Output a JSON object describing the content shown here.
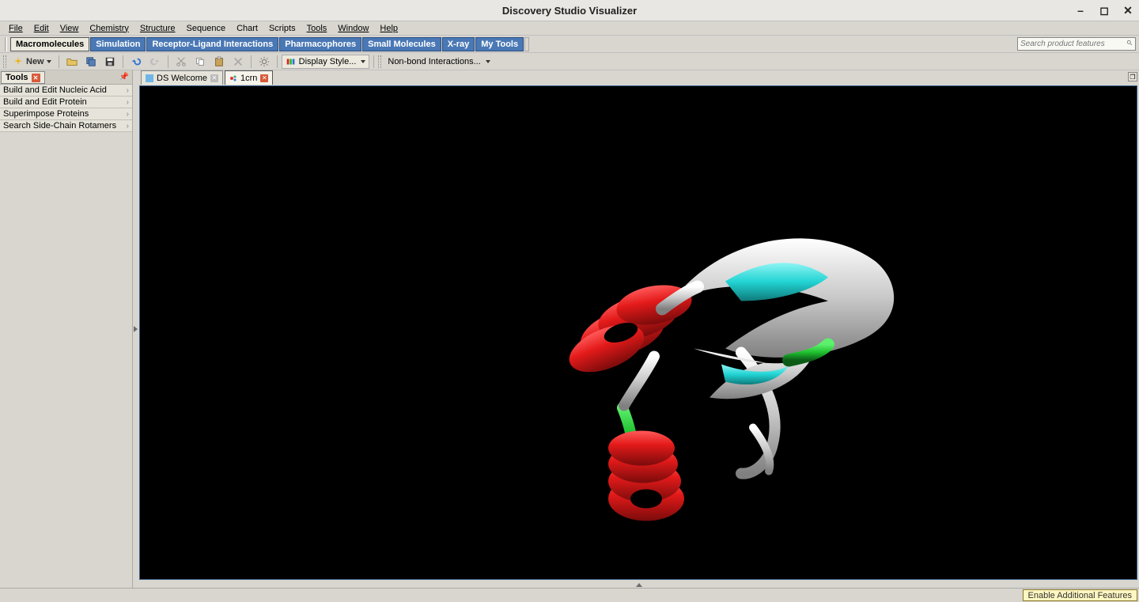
{
  "window": {
    "title": "Discovery Studio Visualizer"
  },
  "menu": [
    "File",
    "Edit",
    "View",
    "Chemistry",
    "Structure",
    "Sequence",
    "Chart",
    "Scripts",
    "Tools",
    "Window",
    "Help"
  ],
  "modules": {
    "items": [
      "Macromolecules",
      "Simulation",
      "Receptor-Ligand Interactions",
      "Pharmacophores",
      "Small Molecules",
      "X-ray",
      "My Tools"
    ],
    "active_index": 0
  },
  "search": {
    "placeholder": "Search product features"
  },
  "toolbar": {
    "new_label": "New",
    "display_style_label": "Display Style...",
    "nonbond_label": "Non-bond Interactions..."
  },
  "sidebar": {
    "title": "Tools",
    "items": [
      "Build and Edit Nucleic Acid",
      "Build and Edit Protein",
      "Superimpose Proteins",
      "Search Side-Chain Rotamers"
    ]
  },
  "tabs": [
    {
      "label": "DS Welcome",
      "icon": "welcome-icon",
      "close_style": "gray",
      "active": false
    },
    {
      "label": "1crn",
      "icon": "molecule-icon",
      "close_style": "red",
      "active": true
    }
  ],
  "statusbar": {
    "enable_label": "Enable Additional Features"
  },
  "viewer": {
    "molecule_id": "1crn",
    "representation": "ribbon",
    "secondary_structure_colors": {
      "helix": "#e41a1a",
      "sheet": "#22d3d3",
      "turn": "#1fbf2f",
      "coil": "#c8c8c8"
    },
    "background": "#000000"
  }
}
